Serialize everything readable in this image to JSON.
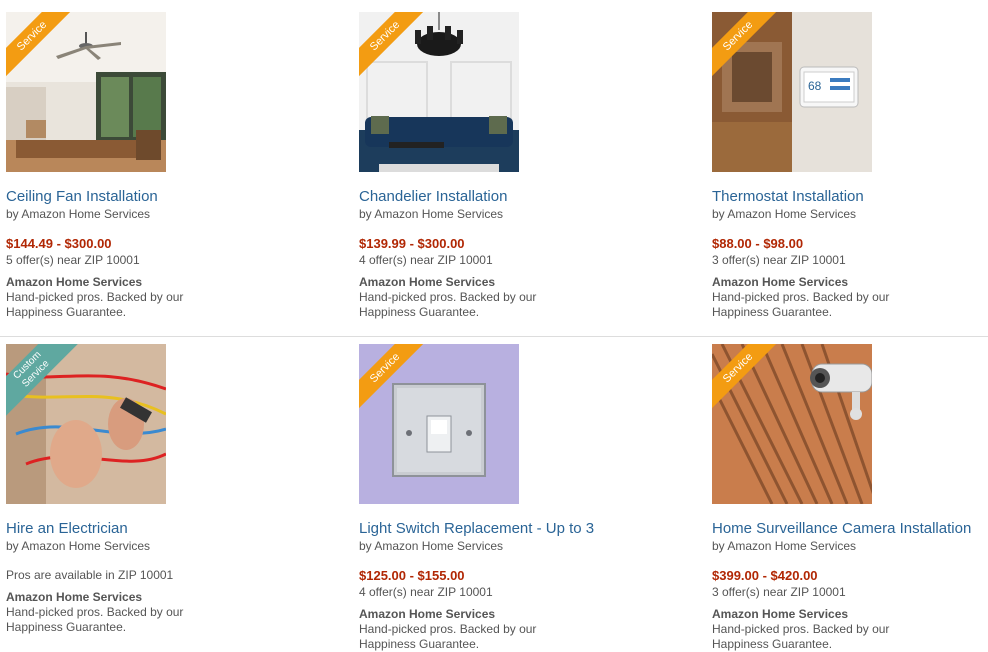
{
  "products": [
    {
      "title": "Ceiling Fan Installation",
      "by": "by Amazon Home Services",
      "price": "$144.49 - $300.00",
      "offers": "5 offer(s) near ZIP 10001",
      "seller": "Amazon Home Services",
      "desc": "Hand-picked pros. Backed by our Happiness Guarantee.",
      "badge": "Service",
      "badge_color": "#f39c12",
      "image_icon": "ceiling-fan-room-image"
    },
    {
      "title": "Chandelier Installation",
      "by": "by Amazon Home Services",
      "price": "$139.99 - $300.00",
      "offers": "4 offer(s) near ZIP 10001",
      "seller": "Amazon Home Services",
      "desc": "Hand-picked pros. Backed by our Happiness Guarantee.",
      "badge": "Service",
      "badge_color": "#f39c12",
      "image_icon": "chandelier-living-room-image"
    },
    {
      "title": "Thermostat Installation",
      "by": "by Amazon Home Services",
      "price": "$88.00 - $98.00",
      "offers": "3 offer(s) near ZIP 10001",
      "seller": "Amazon Home Services",
      "desc": "Hand-picked pros. Backed by our Happiness Guarantee.",
      "badge": "Service",
      "badge_color": "#f39c12",
      "thermostat_reading": "68",
      "image_icon": "thermostat-room-image"
    },
    {
      "title": "Hire an Electrician",
      "by": "by Amazon Home Services",
      "availability": "Pros are available in ZIP 10001",
      "seller": "Amazon Home Services",
      "desc": "Hand-picked pros. Backed by our Happiness Guarantee.",
      "badge": "Custom Service",
      "badge_line1": "Custom",
      "badge_line2": "Service",
      "badge_color": "#5fa8a0",
      "image_icon": "electrician-wires-image"
    },
    {
      "title": "Light Switch Replacement - Up to 3",
      "by": "by Amazon Home Services",
      "price": "$125.00 - $155.00",
      "offers": "4 offer(s) near ZIP 10001",
      "seller": "Amazon Home Services",
      "desc": "Hand-picked pros. Backed by our Happiness Guarantee.",
      "badge": "Service",
      "badge_color": "#f39c12",
      "image_icon": "light-switch-image"
    },
    {
      "title": "Home Surveillance Camera Installation",
      "by": "by Amazon Home Services",
      "price": "$399.00 - $420.00",
      "offers": "3 offer(s) near ZIP 10001",
      "seller": "Amazon Home Services",
      "desc": "Hand-picked pros. Backed by our Happiness Guarantee.",
      "badge": "Service",
      "badge_color": "#f39c12",
      "image_icon": "surveillance-camera-image"
    }
  ]
}
